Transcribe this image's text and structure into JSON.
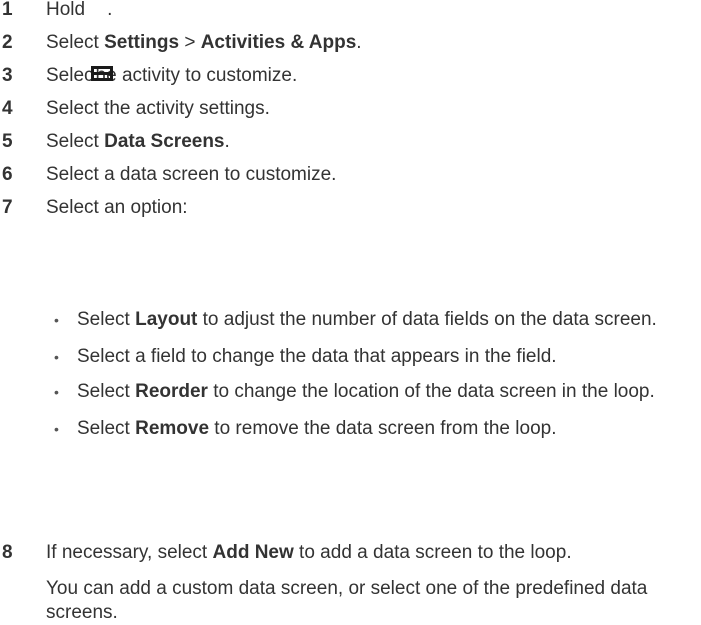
{
  "steps": [
    {
      "num": "1",
      "pre": "Hold",
      "post": "."
    },
    {
      "num": "2",
      "pre": "Select ",
      "b1": "Settings",
      "mid": " > ",
      "b2": "Activities & Apps",
      "post": "."
    },
    {
      "num": "3",
      "pre": "Selec",
      "post": "he activity to customize."
    },
    {
      "num": "4",
      "text": "Select the activity settings."
    },
    {
      "num": "5",
      "pre": "Select ",
      "b1": "Data Screens",
      "post": "."
    },
    {
      "num": "6",
      "text": "Select a data screen to customize."
    },
    {
      "num": "7",
      "text": "Select an option:"
    }
  ],
  "bullets": [
    {
      "pre": "Select ",
      "b": "Layout",
      "post": " to adjust the number of data fields on the data screen."
    },
    {
      "text": "Select a field to change the data that appears in the field."
    },
    {
      "pre": "Select ",
      "b": "Reorder",
      "post": " to change the location of the data screen in the loop."
    },
    {
      "pre": "Select ",
      "b": "Remove",
      "post": " to remove the data screen from the loop."
    }
  ],
  "step8": {
    "num": "8",
    "pre": "If necessary, select ",
    "b": "Add New",
    "post": " to add a data screen to the loop."
  },
  "note": "You can add a custom data screen, or select one of the predefined data screens.",
  "icons": {
    "menu": "menu-icon"
  }
}
